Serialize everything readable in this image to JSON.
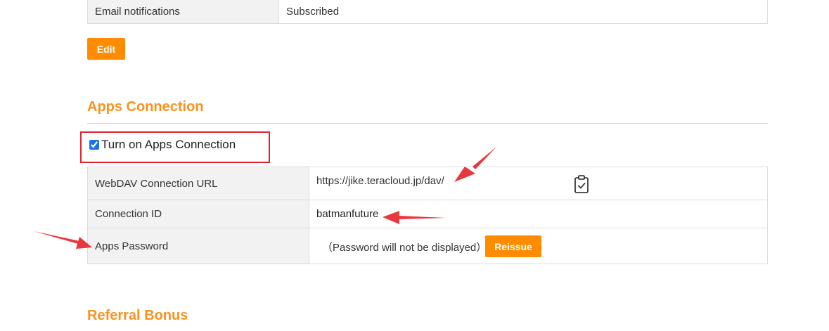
{
  "account_table": {
    "rows": [
      {
        "label": "Email notifications",
        "value": "Subscribed"
      }
    ],
    "edit_label": "Edit"
  },
  "apps_connection": {
    "title": "Apps Connection",
    "checkbox_label": "Turn on Apps Connection",
    "checkbox_checked": true,
    "webdav_label": "WebDAV Connection URL",
    "webdav_url": "https://jike.teracloud.jp/dav/",
    "connection_id_label": "Connection ID",
    "connection_id": "batmanfuture",
    "apps_password_label": "Apps Password",
    "apps_password_note": "（Password will not be displayed）",
    "reissue_label": "Reissue"
  },
  "referral": {
    "title": "Referral Bonus"
  },
  "colors": {
    "accent": "#ff8c00",
    "section_title": "#f7931e",
    "annotation_red": "#e0242f"
  },
  "icons": {
    "clipboard": "clipboard-check-icon"
  }
}
